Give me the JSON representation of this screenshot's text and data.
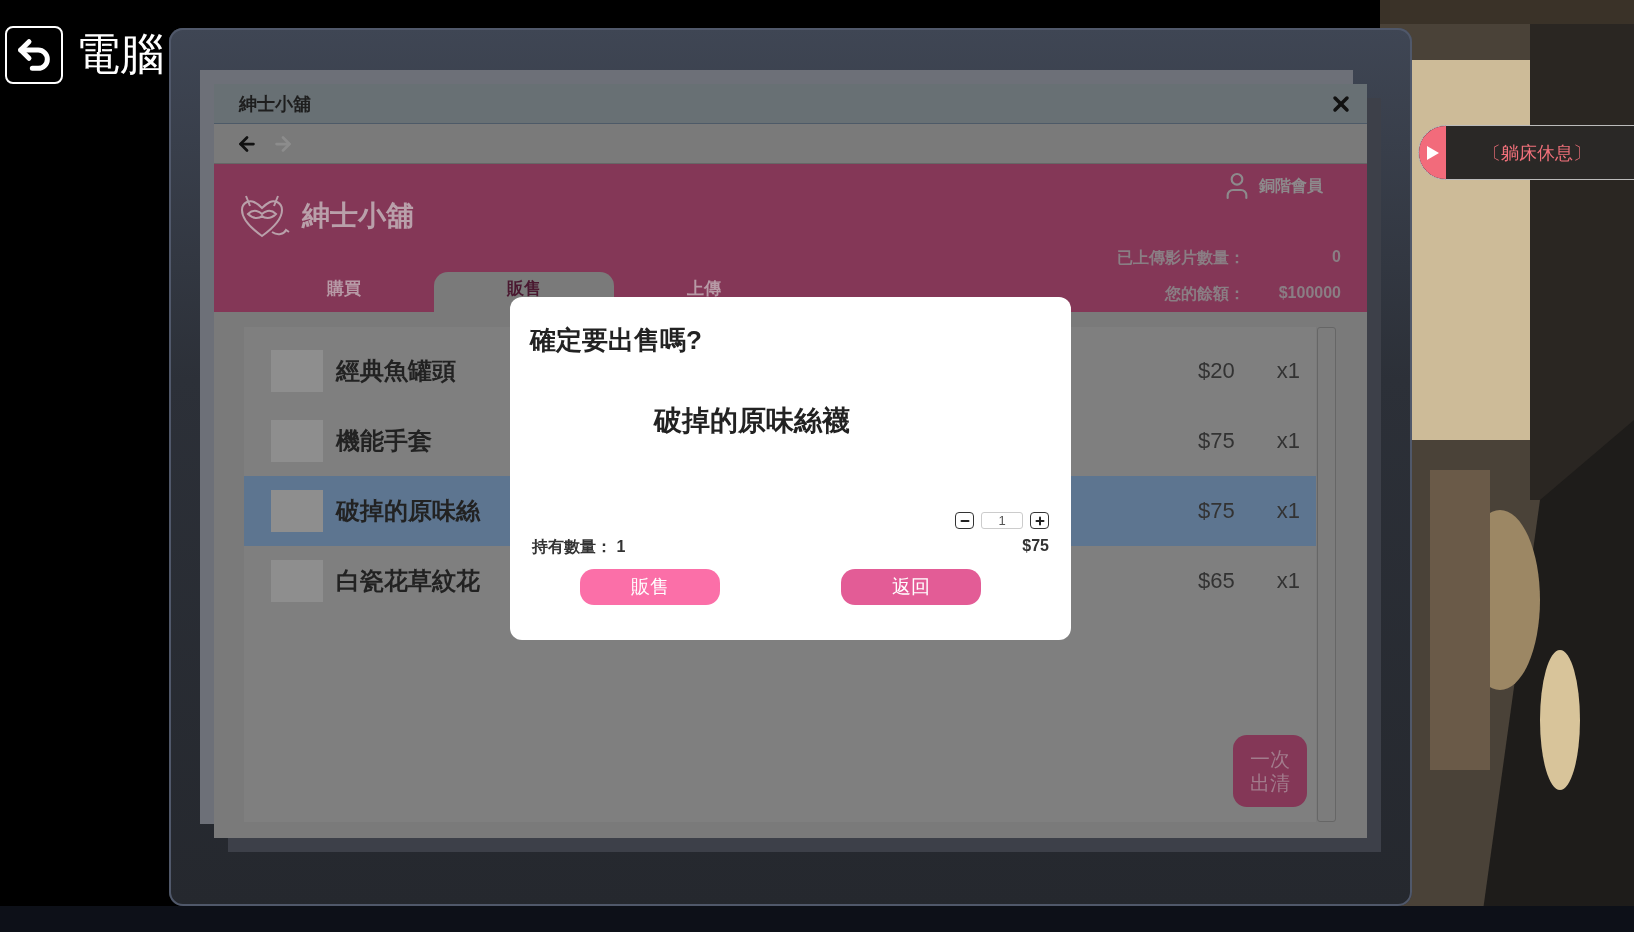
{
  "scene": {
    "back_label": "電腦",
    "rest_action": "〔躺床休息〕"
  },
  "window": {
    "title": "紳士小舖"
  },
  "shop": {
    "name": "紳士小舖",
    "member": "銅階會員",
    "stats": [
      {
        "label": "已上傳影片數量：",
        "value": "0"
      },
      {
        "label": "您的餘額：",
        "value": "$100000"
      }
    ]
  },
  "tabs": [
    {
      "label": "購買",
      "selected": false
    },
    {
      "label": "販售",
      "selected": true
    },
    {
      "label": "上傳",
      "selected": false
    }
  ],
  "items": [
    {
      "name": "經典魚罐頭",
      "price": "$20",
      "quantity": "x1",
      "selected": false
    },
    {
      "name": "機能手套",
      "price": "$75",
      "quantity": "x1",
      "selected": false
    },
    {
      "name": "破掉的原味絲",
      "price": "$75",
      "quantity": "x1",
      "selected": true
    },
    {
      "name": "白瓷花草紋花",
      "price": "$65",
      "quantity": "x1",
      "selected": false
    }
  ],
  "clear_all_button": "一次出清",
  "dialog": {
    "title": "確定要出售嗎?",
    "item": "破掉的原味絲襪",
    "quantity": "1",
    "owned_label": "持有數量：",
    "owned": "1",
    "total": "$75",
    "buttons": [
      {
        "label": "販售",
        "kind": "confirm"
      },
      {
        "label": "返回",
        "kind": "cancel"
      }
    ]
  }
}
